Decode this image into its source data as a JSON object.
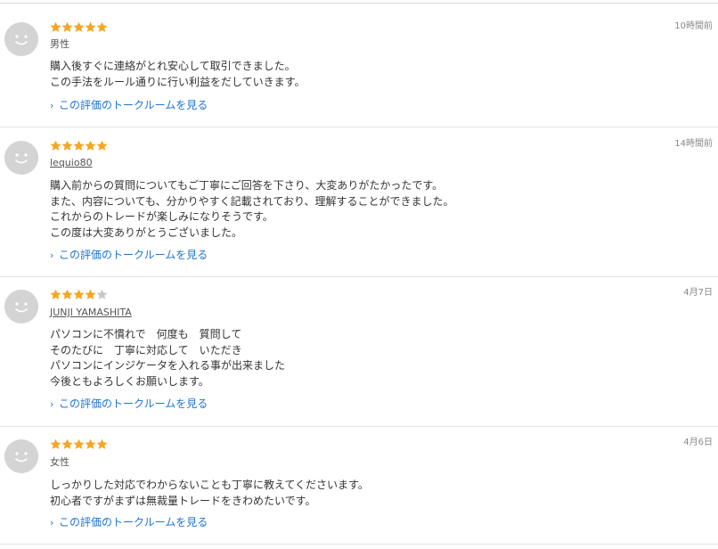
{
  "colors": {
    "star_filled": "#f5a623",
    "star_empty": "#c8c8c8",
    "link": "#1f74d1",
    "avatar_bg": "#d4d4d4"
  },
  "reviews": [
    {
      "rating": 5,
      "username": "男性",
      "username_linked": false,
      "time": "10時間前",
      "comment": "購入後すぐに連絡がとれ安心して取引できました。\nこの手法をルール通りに行い利益をだしていきます。",
      "link_label": "この評価のトークルームを見る"
    },
    {
      "rating": 5,
      "username": "lequio80",
      "username_linked": true,
      "time": "14時間前",
      "comment": "購入前からの質問についてもご丁寧にご回答を下さり、大変ありがたかったです。\nまた、内容についても、分かりやすく記載されており、理解することができました。\nこれからのトレードが楽しみになりそうです。\nこの度は大変ありがとうございました。",
      "link_label": "この評価のトークルームを見る"
    },
    {
      "rating": 4,
      "username": "JUNJI YAMASHITA",
      "username_linked": true,
      "time": "4月7日",
      "comment": "パソコンに不慣れで　何度も　質問して\nそのたびに　丁寧に対応して　いただき\nパソコンにインジケータを入れる事が出来ました\n今後ともよろしくお願いします。",
      "link_label": "この評価のトークルームを見る"
    },
    {
      "rating": 5,
      "username": "女性",
      "username_linked": false,
      "time": "4月6日",
      "comment": "しっかりした対応でわからないことも丁寧に教えてくださいます。\n初心者ですがまずは無裁量トレードをきわめたいです。",
      "link_label": "この評価のトークルームを見る"
    }
  ]
}
